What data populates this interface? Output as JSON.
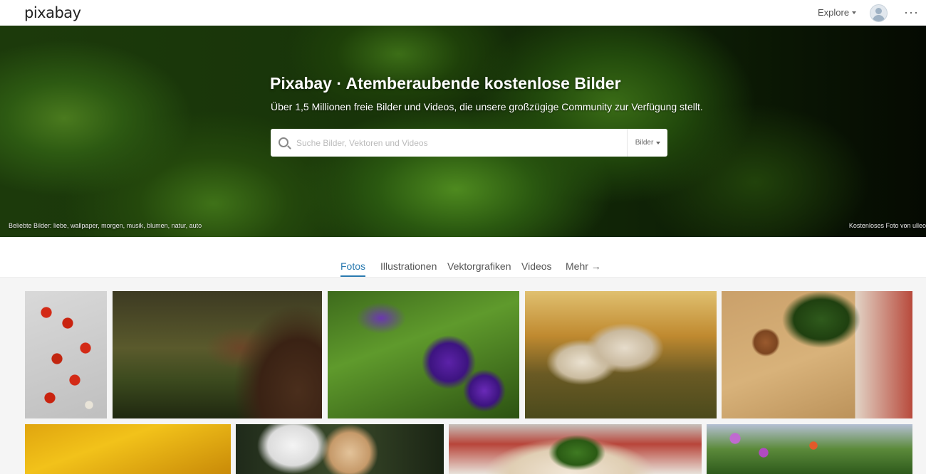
{
  "brand": {
    "logo_text": "pixabay"
  },
  "topnav": {
    "explore_label": "Explore",
    "more_icon": "more-icon"
  },
  "hero": {
    "title": "Pixabay · Atemberaubende kostenlose Bilder",
    "subtitle": "Über 1,5 Millionen freie Bilder und Videos, die unsere großzügige Community zur Verfügung stellt.",
    "search_placeholder": "Suche Bilder, Vektoren und Videos",
    "search_type": "Bilder",
    "popular": "Beliebte Bilder: liebe, wallpaper, morgen, musik, blumen, natur, auto",
    "credit": "Kostenloses Foto von ulleo"
  },
  "tabs": [
    {
      "label": "Fotos",
      "active": true
    },
    {
      "label": "Illustrationen",
      "active": false
    },
    {
      "label": "Vektorgrafiken",
      "active": false
    },
    {
      "label": "Videos",
      "active": false
    },
    {
      "label": "Mehr →",
      "active": false
    }
  ],
  "colors": {
    "accent": "#2a7ab0"
  }
}
